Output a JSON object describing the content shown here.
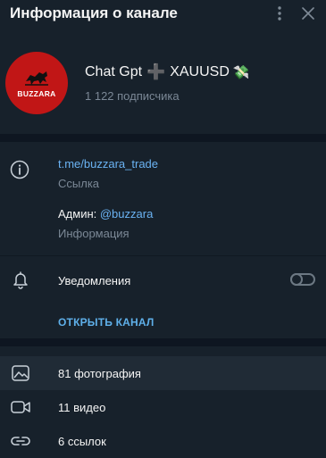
{
  "header": {
    "title": "Информация о канале",
    "more_icon": "more-vertical-icon",
    "close_icon": "close-icon"
  },
  "channel": {
    "avatar_text": "BUZZARA",
    "avatar_color": "#c11616",
    "name_part1": "Chat Gpt",
    "name_plus": "➕",
    "name_part2": "XAUUSD",
    "name_emoji": "💸",
    "subscribers": "1 122 подписчика"
  },
  "info": {
    "link": "t.me/buzzara_trade",
    "link_caption": "Ссылка",
    "admin_prefix": "Админ: ",
    "admin_handle": "@buzzara",
    "admin_caption": "Информация",
    "notifications_label": "Уведомления",
    "notifications_enabled": false,
    "open_channel_label": "ОТКРЫТЬ КАНАЛ"
  },
  "media": [
    {
      "label": "81 фотография",
      "icon": "photo-icon"
    },
    {
      "label": "11 видео",
      "icon": "video-icon"
    },
    {
      "label": "6 ссылок",
      "icon": "link-icon"
    }
  ],
  "colors": {
    "background": "#17212b",
    "separator": "#0e1621",
    "accent": "#6ab2f2",
    "muted": "#7b8896",
    "hover": "#202b36"
  }
}
